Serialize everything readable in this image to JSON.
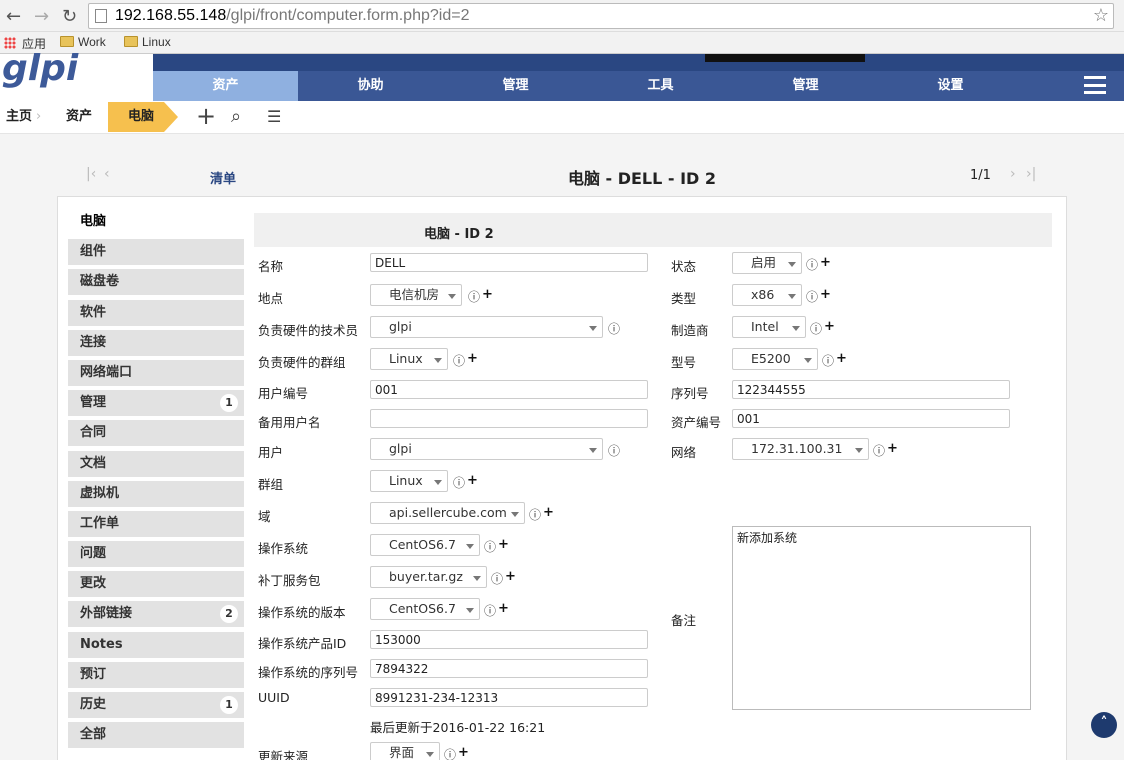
{
  "browser": {
    "url_host": "192.168.55.148",
    "url_path": "/glpi/front/computer.form.php?id=2",
    "bookmarks": [
      "应用",
      "Work",
      "Linux"
    ]
  },
  "app": {
    "logo": "glpi"
  },
  "menu": {
    "items": [
      "资产",
      "协助",
      "管理",
      "工具",
      "管理",
      "设置"
    ],
    "active": "资产"
  },
  "breadcrumb": {
    "home": "主页",
    "section": "资产",
    "current": "电脑"
  },
  "record": {
    "list_link": "清单",
    "title": "电脑 - DELL - ID 2",
    "count": "1/1"
  },
  "tabs": [
    {
      "label": "电脑"
    },
    {
      "label": "组件"
    },
    {
      "label": "磁盘卷"
    },
    {
      "label": "软件"
    },
    {
      "label": "连接"
    },
    {
      "label": "网络端口"
    },
    {
      "label": "管理",
      "badge": "1"
    },
    {
      "label": "合同"
    },
    {
      "label": "文档"
    },
    {
      "label": "虚拟机"
    },
    {
      "label": "工作单"
    },
    {
      "label": "问题"
    },
    {
      "label": "更改"
    },
    {
      "label": "外部链接",
      "badge": "2"
    },
    {
      "label": "Notes"
    },
    {
      "label": "预订"
    },
    {
      "label": "历史",
      "badge": "1"
    },
    {
      "label": "全部"
    }
  ],
  "form": {
    "header": "电脑 - ID 2",
    "name_label": "名称",
    "name_value": "DELL",
    "location_label": "地点",
    "location_value": "电信机房",
    "tech_label": "负责硬件的技术员",
    "tech_value": "glpi",
    "group_tech_label": "负责硬件的群组",
    "group_tech_value": "Linux",
    "usernum_label": "用户编号",
    "usernum_value": "001",
    "altuser_label": "备用用户名",
    "altuser_value": "",
    "user_label": "用户",
    "user_value": "glpi",
    "group_label": "群组",
    "group_value": "Linux",
    "domain_label": "域",
    "domain_value": "api.sellercube.com",
    "os_label": "操作系统",
    "os_value": "CentOS6.7",
    "sp_label": "补丁服务包",
    "sp_value": "buyer.tar.gz",
    "osver_label": "操作系统的版本",
    "osver_value": "CentOS6.7",
    "osprod_label": "操作系统产品ID",
    "osprod_value": "153000",
    "osserial_label": "操作系统的序列号",
    "osserial_value": "7894322",
    "uuid_label": "UUID",
    "uuid_value": "8991231-234-12313",
    "last_update": "最后更新于2016-01-22 16:21",
    "source_label": "更新来源",
    "source_value": "界面",
    "status_label": "状态",
    "status_value": "启用",
    "type_label": "类型",
    "type_value": "x86",
    "manuf_label": "制造商",
    "manuf_value": "Intel",
    "model_label": "型号",
    "model_value": "E5200",
    "serial_label": "序列号",
    "serial_value": "122344555",
    "asset_label": "资产编号",
    "asset_value": "001",
    "network_label": "网络",
    "network_value": "172.31.100.31",
    "notes_label": "备注",
    "notes_value": "新添加系统"
  }
}
